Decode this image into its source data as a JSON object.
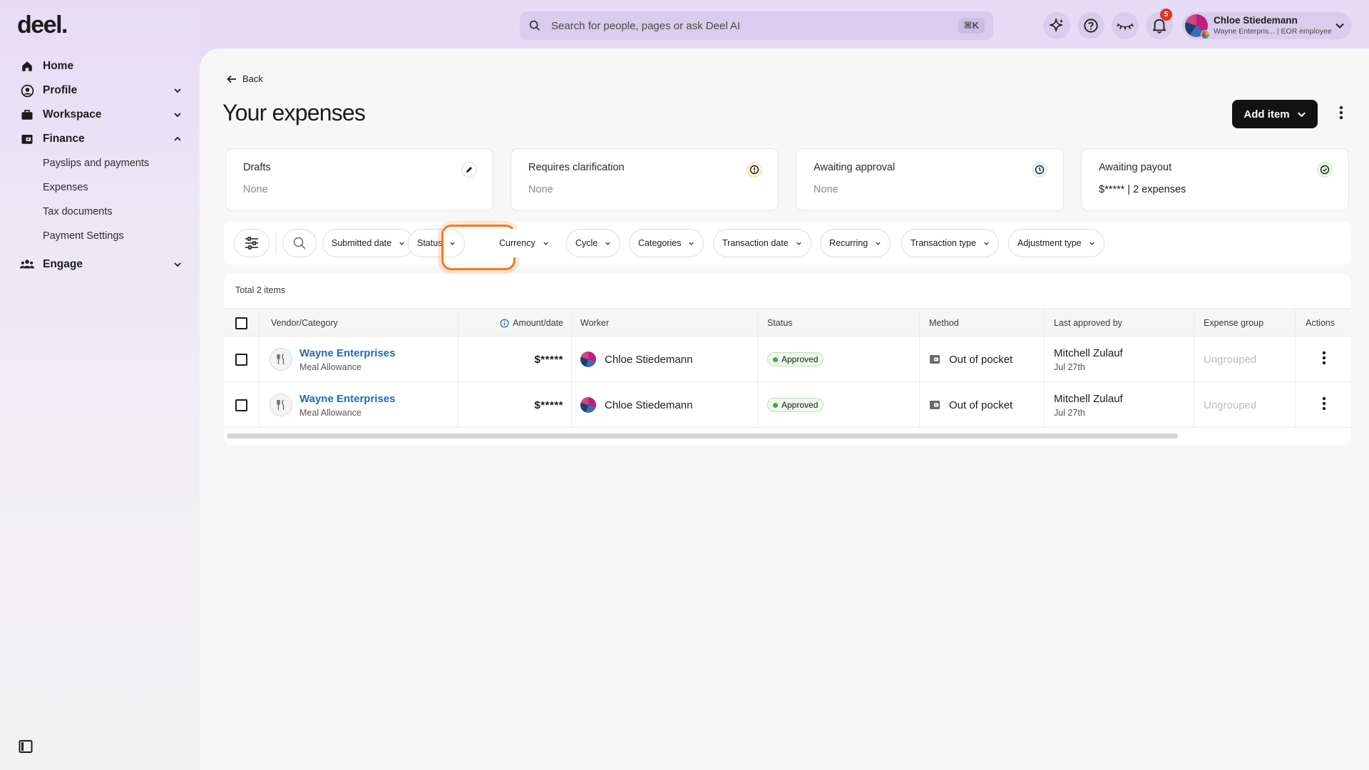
{
  "brand": {
    "logo": "deel."
  },
  "sidebar": {
    "items": [
      {
        "label": "Home",
        "icon": "home-icon"
      },
      {
        "label": "Profile",
        "icon": "user-circle-icon",
        "expanded": false
      },
      {
        "label": "Workspace",
        "icon": "briefcase-icon",
        "expanded": false
      },
      {
        "label": "Finance",
        "icon": "wallet-icon",
        "expanded": true
      },
      {
        "label": "Engage",
        "icon": "people-icon",
        "expanded": false
      }
    ],
    "finance_sub": [
      "Payslips and payments",
      "Expenses",
      "Tax documents",
      "Payment Settings"
    ]
  },
  "topbar": {
    "search_placeholder": "Search for people, pages or ask Deel AI",
    "search_shortcut": "⌘K",
    "notification_count": "5",
    "user": {
      "name": "Chloe Stiedemann",
      "subtitle": "Wayne Enterpris... | EOR employee"
    }
  },
  "page": {
    "back_label": "Back",
    "title": "Your expenses",
    "add_button": "Add item"
  },
  "summary_cards": [
    {
      "title": "Drafts",
      "value": "None",
      "icon": "pencil-icon"
    },
    {
      "title": "Requires clarification",
      "value": "None",
      "icon": "info-icon"
    },
    {
      "title": "Awaiting approval",
      "value": "None",
      "icon": "clock-icon"
    },
    {
      "title": "Awaiting payout",
      "value": "$***** | 2 expenses",
      "icon": "check-circle-icon"
    }
  ],
  "filters": [
    "Submitted date",
    "Status",
    "Currency",
    "Cycle",
    "Categories",
    "Transaction date",
    "Recurring",
    "Transaction type",
    "Adjustment type"
  ],
  "table": {
    "total_label": "Total 2 items",
    "columns": [
      "Vendor/Category",
      "Amount/date",
      "Worker",
      "Status",
      "Method",
      "Last approved by",
      "Expense group",
      "Actions"
    ],
    "rows": [
      {
        "vendor": "Wayne Enterprises",
        "category": "Meal Allowance",
        "amount": "$*****",
        "worker": "Chloe Stiedemann",
        "status": "Approved",
        "method": "Out of pocket",
        "approver": "Mitchell Zulauf",
        "approved_date": "Jul 27th",
        "group": "Ungrouped"
      },
      {
        "vendor": "Wayne Enterprises",
        "category": "Meal Allowance",
        "amount": "$*****",
        "worker": "Chloe Stiedemann",
        "status": "Approved",
        "method": "Out of pocket",
        "approver": "Mitchell Zulauf",
        "approved_date": "Jul 27th",
        "group": "Ungrouped"
      }
    ]
  },
  "colors": {
    "accent_purple": "#e6dcf6",
    "highlight_orange": "#f27b1f",
    "link_blue": "#1f6bb8",
    "approved_green": "#3caa4f"
  }
}
